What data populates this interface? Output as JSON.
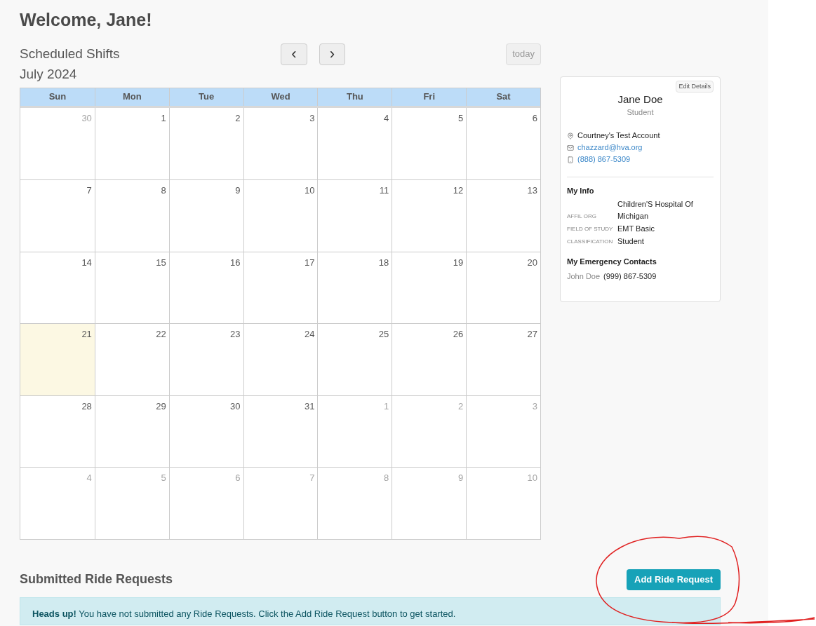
{
  "greeting": "Welcome, Jane!",
  "calendar": {
    "title": "Scheduled Shifts",
    "month": "July 2024",
    "prev": "‹",
    "next": "›",
    "today_button": "today",
    "weekdays": [
      "Sun",
      "Mon",
      "Tue",
      "Wed",
      "Thu",
      "Fri",
      "Sat"
    ],
    "weeks": [
      [
        {
          "day": "30",
          "other_month": true,
          "today": false
        },
        {
          "day": "1",
          "other_month": false,
          "today": false
        },
        {
          "day": "2",
          "other_month": false,
          "today": false
        },
        {
          "day": "3",
          "other_month": false,
          "today": false
        },
        {
          "day": "4",
          "other_month": false,
          "today": false
        },
        {
          "day": "5",
          "other_month": false,
          "today": false
        },
        {
          "day": "6",
          "other_month": false,
          "today": false
        }
      ],
      [
        {
          "day": "7",
          "other_month": false,
          "today": false
        },
        {
          "day": "8",
          "other_month": false,
          "today": false
        },
        {
          "day": "9",
          "other_month": false,
          "today": false
        },
        {
          "day": "10",
          "other_month": false,
          "today": false
        },
        {
          "day": "11",
          "other_month": false,
          "today": false
        },
        {
          "day": "12",
          "other_month": false,
          "today": false
        },
        {
          "day": "13",
          "other_month": false,
          "today": false
        }
      ],
      [
        {
          "day": "14",
          "other_month": false,
          "today": false
        },
        {
          "day": "15",
          "other_month": false,
          "today": false
        },
        {
          "day": "16",
          "other_month": false,
          "today": false
        },
        {
          "day": "17",
          "other_month": false,
          "today": false
        },
        {
          "day": "18",
          "other_month": false,
          "today": false
        },
        {
          "day": "19",
          "other_month": false,
          "today": false
        },
        {
          "day": "20",
          "other_month": false,
          "today": false
        }
      ],
      [
        {
          "day": "21",
          "other_month": false,
          "today": true
        },
        {
          "day": "22",
          "other_month": false,
          "today": false
        },
        {
          "day": "23",
          "other_month": false,
          "today": false
        },
        {
          "day": "24",
          "other_month": false,
          "today": false
        },
        {
          "day": "25",
          "other_month": false,
          "today": false
        },
        {
          "day": "26",
          "other_month": false,
          "today": false
        },
        {
          "day": "27",
          "other_month": false,
          "today": false
        }
      ],
      [
        {
          "day": "28",
          "other_month": false,
          "today": false
        },
        {
          "day": "29",
          "other_month": false,
          "today": false
        },
        {
          "day": "30",
          "other_month": false,
          "today": false
        },
        {
          "day": "31",
          "other_month": false,
          "today": false
        },
        {
          "day": "1",
          "other_month": true,
          "today": false
        },
        {
          "day": "2",
          "other_month": true,
          "today": false
        },
        {
          "day": "3",
          "other_month": true,
          "today": false
        }
      ],
      [
        {
          "day": "4",
          "other_month": true,
          "today": false
        },
        {
          "day": "5",
          "other_month": true,
          "today": false
        },
        {
          "day": "6",
          "other_month": true,
          "today": false
        },
        {
          "day": "7",
          "other_month": true,
          "today": false
        },
        {
          "day": "8",
          "other_month": true,
          "today": false
        },
        {
          "day": "9",
          "other_month": true,
          "today": false
        },
        {
          "day": "10",
          "other_month": true,
          "today": false
        }
      ]
    ]
  },
  "profile": {
    "edit_button": "Edit Details",
    "name": "Jane Doe",
    "role": "Student",
    "contacts": [
      {
        "kind": "location",
        "text": "Courtney's Test Account"
      },
      {
        "kind": "email",
        "text": "chazzard@hva.org"
      },
      {
        "kind": "phone",
        "text": "(888) 867-5309"
      }
    ],
    "info_title": "My Info",
    "info": [
      {
        "label": "AFFIL ORG",
        "value": "Children'S Hospital Of Michigan"
      },
      {
        "label": "FIELD OF STUDY",
        "value": "EMT Basic"
      },
      {
        "label": "CLASSIFICATION",
        "value": "Student"
      }
    ],
    "emergency_title": "My Emergency Contacts",
    "emergency": [
      {
        "name": "John Doe",
        "phone": "(999) 867-5309"
      }
    ]
  },
  "ride_requests": {
    "title": "Submitted Ride Requests",
    "add_button": "Add Ride Request",
    "alert": "**Heads up!** You have not submitted any Ride Requests. Click the Add Ride Request button to get started."
  }
}
